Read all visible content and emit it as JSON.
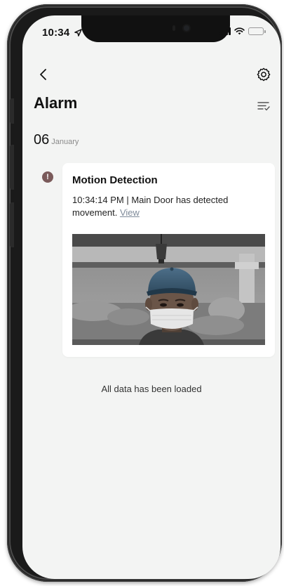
{
  "status_bar": {
    "time": "10:34",
    "location_icon": "location-arrow-icon",
    "signal_icon": "cellular-signal-icon",
    "wifi_icon": "wifi-icon",
    "battery_icon": "battery-icon"
  },
  "nav": {
    "back_icon": "chevron-left-icon",
    "settings_icon": "gear-icon"
  },
  "header": {
    "title": "Alarm",
    "filter_icon": "list-check-icon"
  },
  "date_group": {
    "day": "06",
    "month": "January"
  },
  "events": [
    {
      "indicator": "!",
      "indicator_color": "#7a5a5a",
      "title": "Motion Detection",
      "description": "10:34:14 PM | Main Door  has detected movement.",
      "link_label": "View",
      "snapshot_icon": "camera-snapshot-image"
    }
  ],
  "footer": {
    "load_status": "All data has been loaded"
  },
  "colors": {
    "screen_background": "#f3f4f3",
    "card_background": "#ffffff",
    "link": "#7e8a99"
  }
}
